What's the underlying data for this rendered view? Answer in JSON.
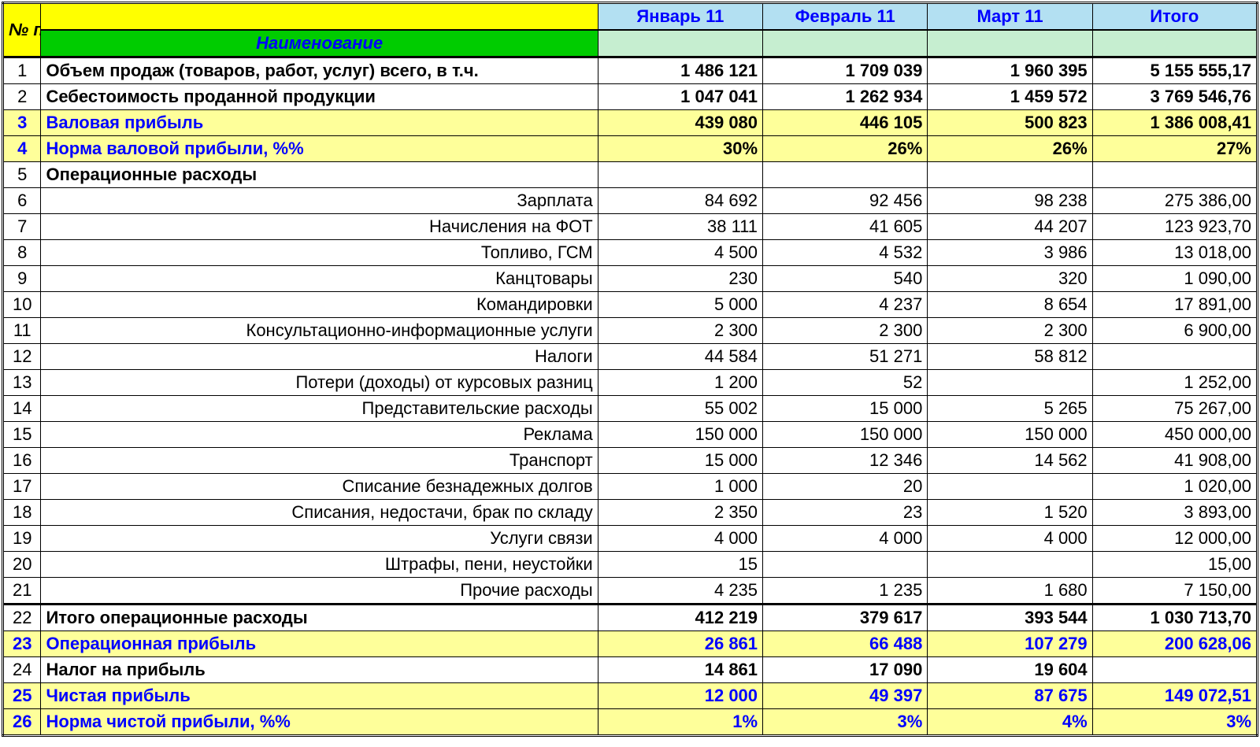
{
  "header": {
    "row_number_label": "№ п/п",
    "name_label": "Наименование",
    "columns": [
      "Январь 11",
      "Февраль 11",
      "Март 11",
      "Итого"
    ]
  },
  "rows": [
    {
      "n": "1",
      "label": "Объем продаж (товаров, работ, услуг) всего,  в т.ч.",
      "style": "headbold",
      "vals": [
        "1 486 121",
        "1 709 039",
        "1 960 395",
        "5 155 555,17"
      ]
    },
    {
      "n": "2",
      "label": "Себестоимость проданной продукции",
      "style": "headbold",
      "vals": [
        "1 047 041",
        "1 262 934",
        "1 459 572",
        "3 769 546,76"
      ]
    },
    {
      "n": "3",
      "label": "Валовая прибыль",
      "style": "sum-black",
      "vals": [
        "439 080",
        "446 105",
        "500 823",
        "1 386 008,41"
      ]
    },
    {
      "n": "4",
      "label": "Норма валовой прибыли, %%",
      "style": "sum-black",
      "vals": [
        "30%",
        "26%",
        "26%",
        "27%"
      ]
    },
    {
      "n": "5",
      "label": "Операционные расходы",
      "style": "headbold",
      "vals": [
        "",
        "",
        "",
        ""
      ]
    },
    {
      "n": "6",
      "label": "Зарплата",
      "style": "sub",
      "vals": [
        "84 692",
        "92 456",
        "98 238",
        "275 386,00"
      ]
    },
    {
      "n": "7",
      "label": "Начисления на ФОТ",
      "style": "sub",
      "vals": [
        "38 111",
        "41 605",
        "44 207",
        "123 923,70"
      ]
    },
    {
      "n": "8",
      "label": "Топливо, ГСМ",
      "style": "sub",
      "vals": [
        "4 500",
        "4 532",
        "3 986",
        "13 018,00"
      ]
    },
    {
      "n": "9",
      "label": "Канцтовары",
      "style": "sub",
      "vals": [
        "230",
        "540",
        "320",
        "1 090,00"
      ]
    },
    {
      "n": "10",
      "label": "Командировки",
      "style": "sub",
      "vals": [
        "5 000",
        "4 237",
        "8 654",
        "17 891,00"
      ]
    },
    {
      "n": "11",
      "label": "Консультационно-информационные услуги",
      "style": "sub",
      "vals": [
        "2 300",
        "2 300",
        "2 300",
        "6 900,00"
      ]
    },
    {
      "n": "12",
      "label": "Налоги",
      "style": "sub",
      "vals": [
        "44 584",
        "51 271",
        "58 812",
        ""
      ]
    },
    {
      "n": "13",
      "label": "Потери (доходы) от курсовых разниц",
      "style": "sub",
      "vals": [
        "1 200",
        "52",
        "",
        "1 252,00"
      ]
    },
    {
      "n": "14",
      "label": "Представительские расходы",
      "style": "sub",
      "vals": [
        "55 002",
        "15 000",
        "5 265",
        "75 267,00"
      ]
    },
    {
      "n": "15",
      "label": "Реклама",
      "style": "sub",
      "vals": [
        "150 000",
        "150 000",
        "150 000",
        "450 000,00"
      ]
    },
    {
      "n": "16",
      "label": "Транспорт",
      "style": "sub",
      "vals": [
        "15 000",
        "12 346",
        "14 562",
        "41 908,00"
      ]
    },
    {
      "n": "17",
      "label": "Списание безнадежных долгов",
      "style": "sub",
      "vals": [
        "1 000",
        "20",
        "",
        "1 020,00"
      ]
    },
    {
      "n": "18",
      "label": "Списания, недостачи, брак по складу",
      "style": "sub",
      "vals": [
        "2 350",
        "23",
        "1 520",
        "3 893,00"
      ]
    },
    {
      "n": "19",
      "label": "Услуги связи",
      "style": "sub",
      "vals": [
        "4 000",
        "4 000",
        "4 000",
        "12 000,00"
      ]
    },
    {
      "n": "20",
      "label": "Штрафы, пени, неустойки",
      "style": "sub",
      "vals": [
        "15",
        "",
        "",
        "15,00"
      ]
    },
    {
      "n": "21",
      "label": "Прочие расходы",
      "style": "sub",
      "vals": [
        "4 235",
        "1 235",
        "1 680",
        "7 150,00"
      ]
    },
    {
      "n": "22",
      "label": "Итого операционные расходы",
      "style": "totalbold",
      "vals": [
        "412 219",
        "379 617",
        "393 544",
        "1 030 713,70"
      ]
    },
    {
      "n": "23",
      "label": "Операционная прибыль",
      "style": "sum-blue",
      "vals": [
        "26 861",
        "66 488",
        "107 279",
        "200 628,06"
      ]
    },
    {
      "n": "24",
      "label": "Налог на прибыль",
      "style": "headbold",
      "vals": [
        "14 861",
        "17 090",
        "19 604",
        ""
      ]
    },
    {
      "n": "25",
      "label": "Чистая прибыль",
      "style": "sum-blue",
      "vals": [
        "12 000",
        "49 397",
        "87 675",
        "149 072,51"
      ]
    },
    {
      "n": "26",
      "label": "Норма чистой прибыли, %%",
      "style": "sum-blue",
      "vals": [
        "1%",
        "3%",
        "4%",
        "3%"
      ]
    }
  ]
}
